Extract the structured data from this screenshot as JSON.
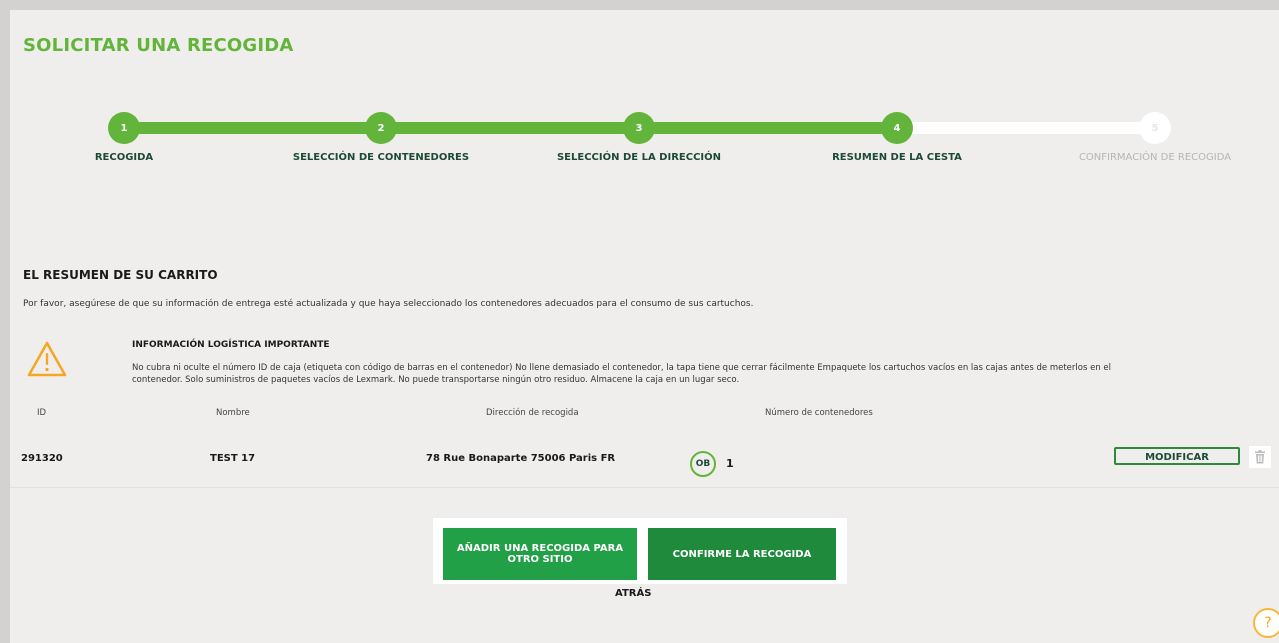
{
  "header": {
    "title": "SOLICITAR UNA RECOGIDA"
  },
  "stepper": {
    "steps": [
      {
        "number": "1",
        "label": "RECOGIDA",
        "status": "complete"
      },
      {
        "number": "2",
        "label": "SELECCIÓN DE CONTENEDORES",
        "status": "complete"
      },
      {
        "number": "3",
        "label": "SELECCIÓN DE LA DIRECCIÓN",
        "status": "complete"
      },
      {
        "number": "4",
        "label": "RESUMEN DE LA CESTA",
        "status": "current"
      },
      {
        "number": "5",
        "label": "CONFIRMACIÓN DE RECOGIDA",
        "status": "pending"
      }
    ]
  },
  "summary": {
    "title": "EL RESUMEN DE SU CARRITO",
    "description": "Por favor, asegúrese de que su información de entrega esté actualizada y que haya seleccionado los contenedores adecuados para el consumo de sus cartuchos.",
    "info_title": "INFORMACIÓN LOGÍSTICA IMPORTANTE",
    "info_text": "No cubra ni oculte el número ID de caja (etiqueta con código de barras en el contenedor) No llene demasiado el contenedor, la tapa tiene que cerrar fácilmente Empaquete los cartuchos vacíos en las cajas antes de meterlos en el contenedor. Solo suministros de paquetes vacíos de Lexmark. No puede transportarse ningún otro residuo. Almacene la caja en un lugar seco.",
    "warning_icon": "warning-triangle-icon"
  },
  "table": {
    "headers": {
      "id": "ID",
      "name": "Nombre",
      "address": "Dirección de recogida",
      "containers": "Número de contenedores"
    },
    "rows": [
      {
        "id": "291320",
        "name": "TEST 17",
        "address": "78 Rue Bonaparte 75006 Paris FR",
        "container_code": "OB",
        "container_count": "1",
        "modify_label": "MODIFICAR"
      }
    ]
  },
  "actions": {
    "add_label": "AÑADIR UNA RECOGIDA PARA OTRO SITIO",
    "confirm_label": "CONFIRME LA RECOGIDA",
    "back_label": "ATRÁS",
    "help_glyph": "?"
  },
  "colors": {
    "accent_green": "#62b43a",
    "dark_green": "#1d4a36",
    "button_green": "#22a048",
    "button_green_dark": "#1f8a3b",
    "warning_orange": "#f5a623"
  }
}
